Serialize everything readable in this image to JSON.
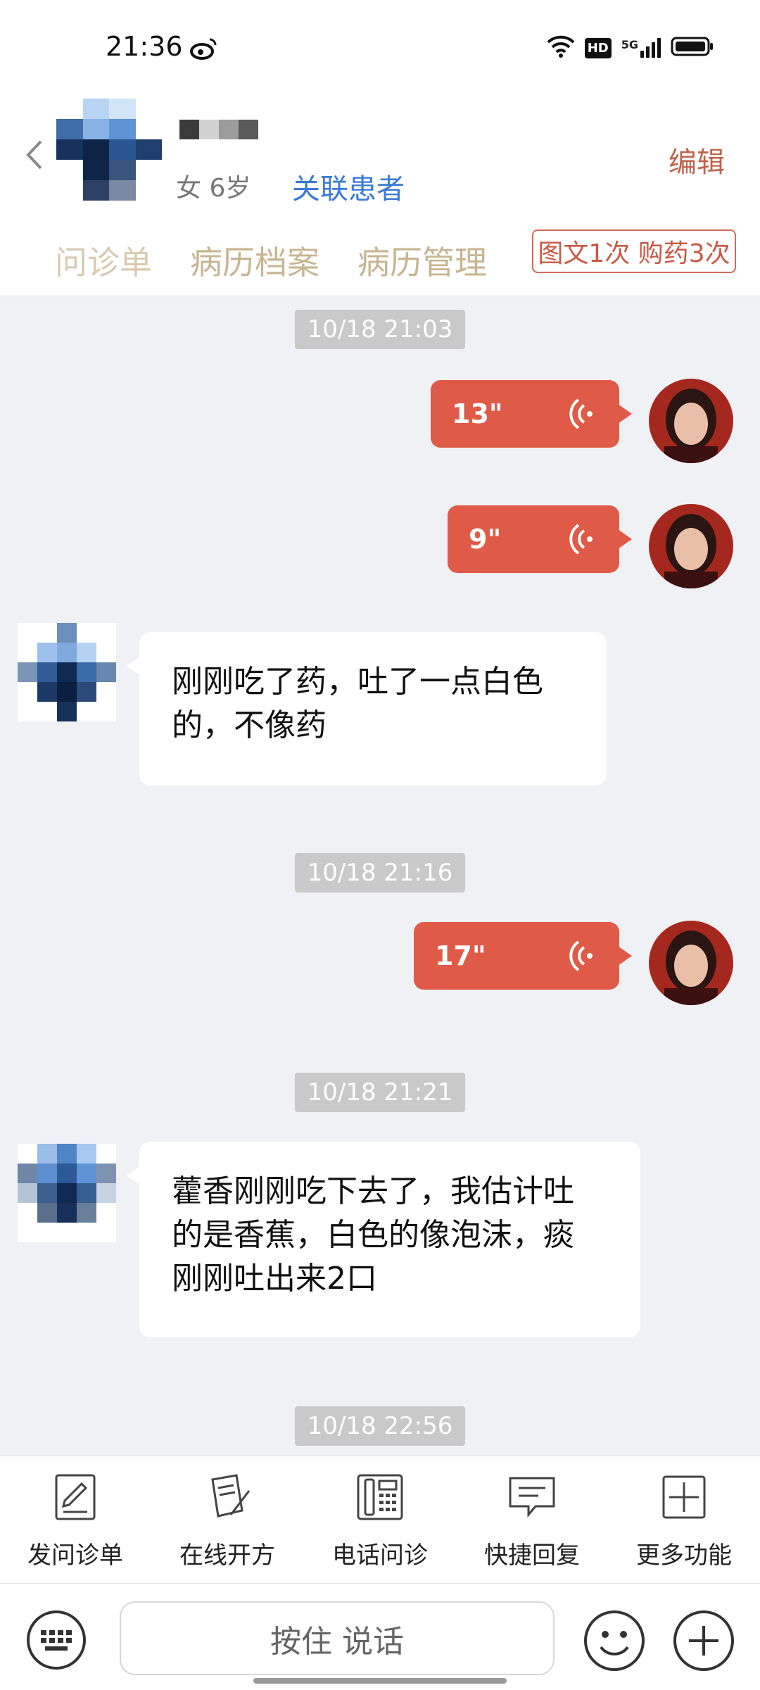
{
  "status_bar": {
    "time": "21:36",
    "hd_label": "HD",
    "network_label": "5G"
  },
  "header": {
    "patient_info": "女 6岁",
    "link_patient": "关联患者",
    "edit": "编辑",
    "tabs": [
      "问诊单",
      "病历档案",
      "病历管理"
    ],
    "counter": "图文1次 购药3次"
  },
  "chat": {
    "messages": [
      {
        "type": "timestamp",
        "text": "10/18 21:03"
      },
      {
        "type": "voice",
        "sender": "doctor",
        "duration": "13\""
      },
      {
        "type": "voice",
        "sender": "doctor",
        "duration": "9\""
      },
      {
        "type": "text",
        "sender": "patient",
        "lines": [
          "刚刚吃了药，吐了一点白色",
          "的，不像药"
        ]
      },
      {
        "type": "timestamp",
        "text": "10/18 21:16"
      },
      {
        "type": "voice",
        "sender": "doctor",
        "duration": "17\""
      },
      {
        "type": "timestamp",
        "text": "10/18 21:21"
      },
      {
        "type": "text",
        "sender": "patient",
        "lines": [
          "藿香刚刚吃下去了，我估计吐",
          "的是香蕉，白色的像泡沫，痰",
          "刚刚吐出来2口"
        ]
      },
      {
        "type": "timestamp",
        "text": "10/18 22:56"
      }
    ]
  },
  "toolbar": {
    "items": [
      {
        "label": "发问诊单",
        "icon": "form-edit-icon"
      },
      {
        "label": "在线开方",
        "icon": "prescription-pen-icon"
      },
      {
        "label": "电话问诊",
        "icon": "phone-icon"
      },
      {
        "label": "快捷回复",
        "icon": "message-icon"
      },
      {
        "label": "更多功能",
        "icon": "plus-square-icon"
      }
    ]
  },
  "input_bar": {
    "talk_label": "按住 说话"
  },
  "colors": {
    "accent": "#e05a48",
    "link": "#3a7bd5",
    "tab_text": "#c8b592",
    "edit": "#c0634b"
  }
}
